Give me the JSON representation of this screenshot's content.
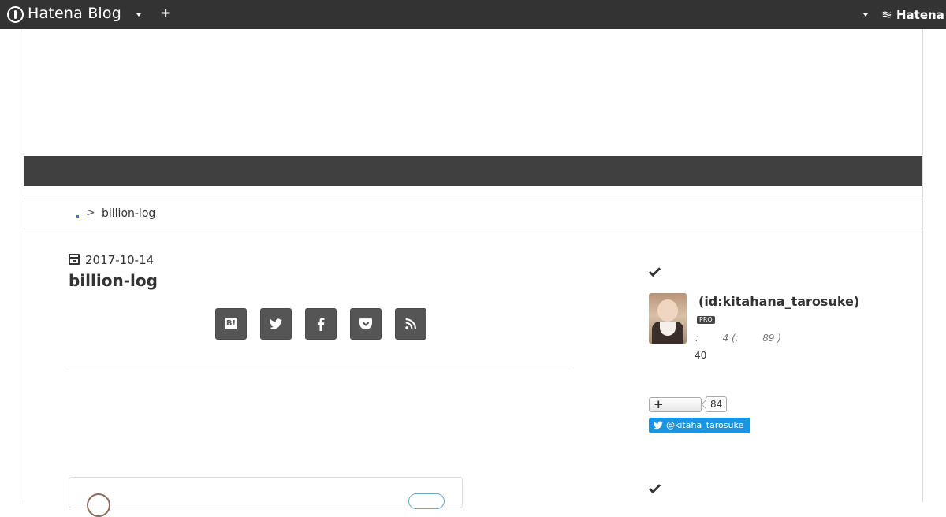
{
  "topbar": {
    "logo_text": "Hatena Blog",
    "hatena_label": "Hatena",
    "plus_label": "+"
  },
  "breadcrumb": {
    "separator": ">",
    "current": "billion-log"
  },
  "article": {
    "date": "2017-10-14",
    "title": "billion-log",
    "share_buttons": [
      "hatena-bookmark",
      "twitter",
      "facebook",
      "pocket",
      "rss"
    ],
    "hatebu_label": "B!"
  },
  "sidebar": {
    "profile": {
      "user_id": "(id:kitahana_tarosuke)",
      "pro_label": "PRO",
      "stats": ":        4 (:        89 )",
      "count": "40"
    },
    "follow": {
      "plus_label": "+",
      "count": "84"
    },
    "twitter": {
      "handle": "@kitaha_tarosuke"
    }
  },
  "colors": {
    "topbar": "#333333",
    "band": "#404040",
    "share_button": "#555555",
    "twitter": "#1b95e0"
  }
}
